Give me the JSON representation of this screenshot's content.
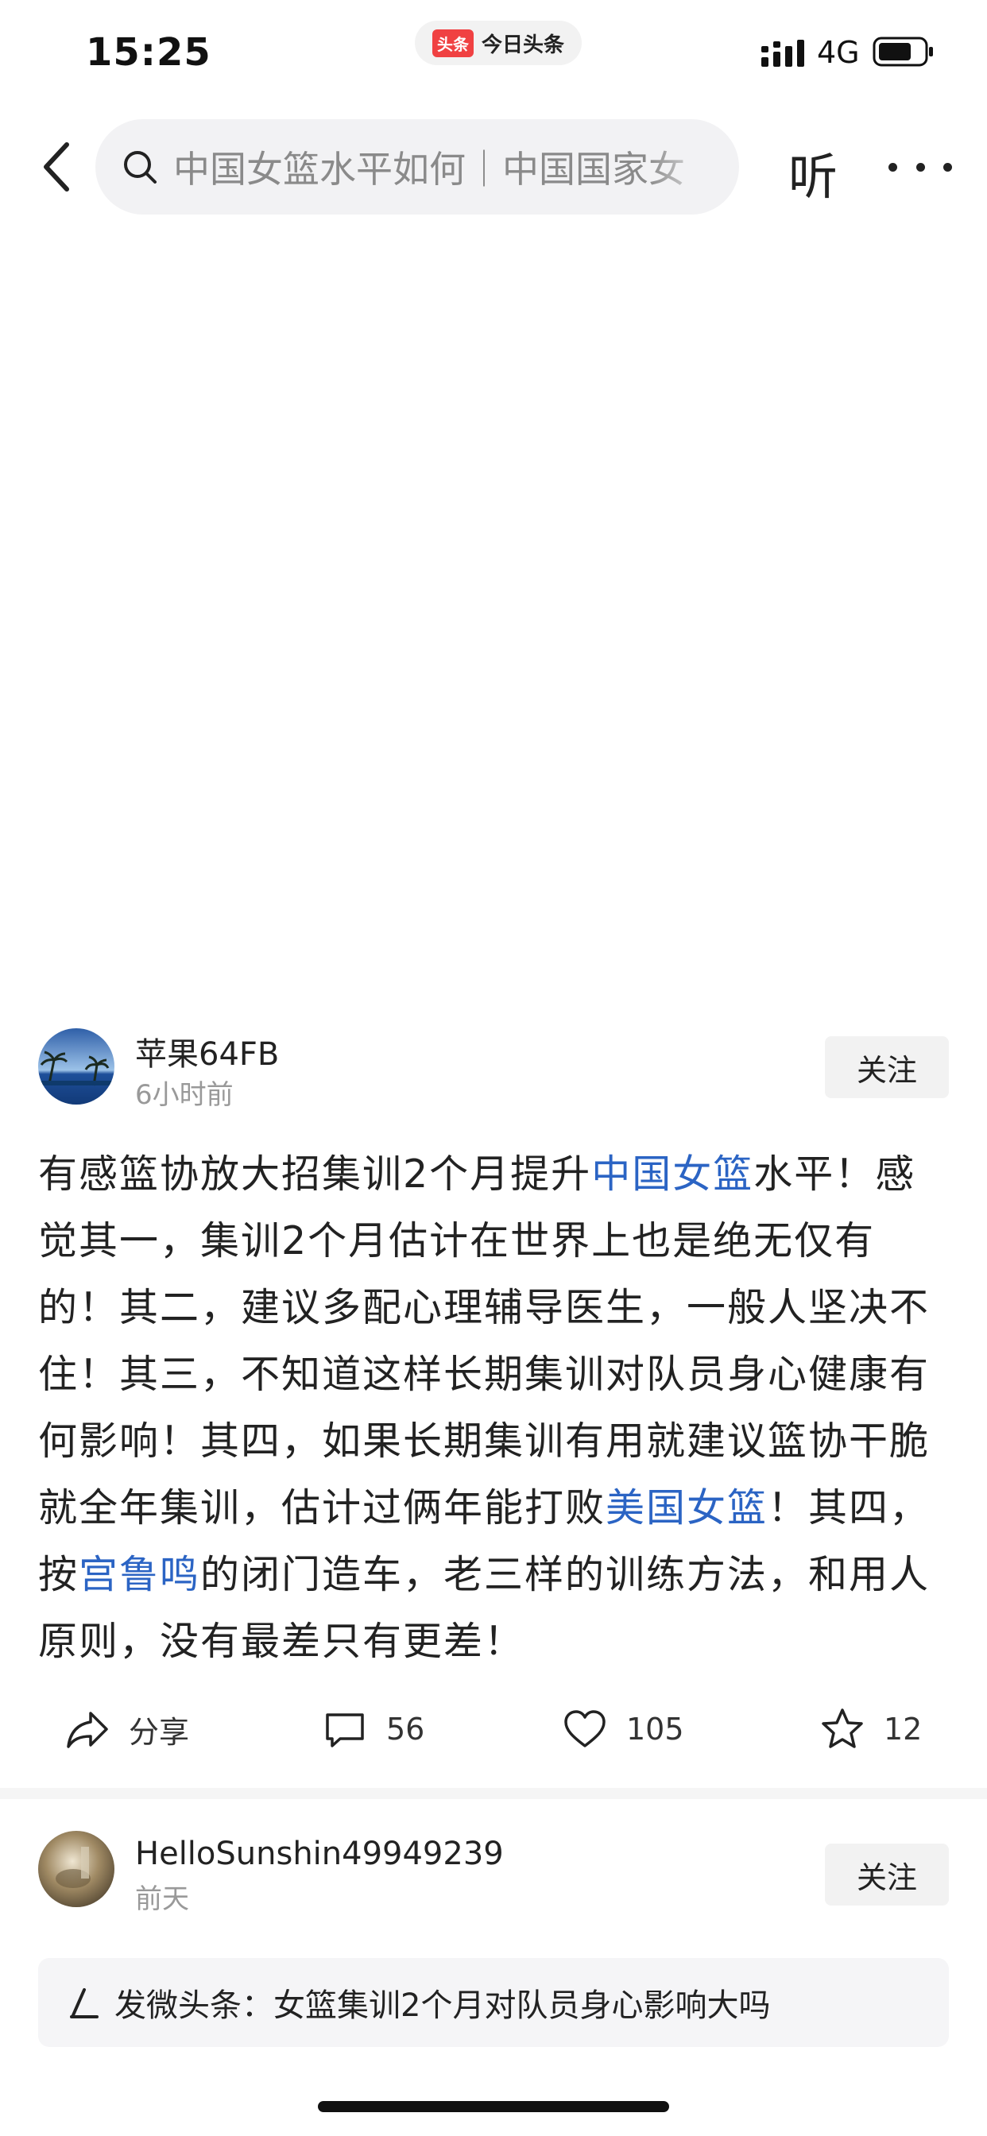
{
  "status_bar": {
    "time": "15:25",
    "app_logo": "头条",
    "app_name": "今日头条",
    "network": "4G",
    "icons": [
      "signal-icon",
      "battery-icon"
    ]
  },
  "nav": {
    "back_icon": "chevron-left-icon",
    "search_icon": "search-icon",
    "search_text": "中国女篮水平如何｜中国国家女",
    "listen_label": "听",
    "more_icon": "more-dots-icon"
  },
  "post": {
    "author": "苹果64FB",
    "time": "6小时前",
    "follow_label": "关注",
    "body": {
      "t1": "有感篮协放大招集训2个月提升",
      "l1": "中国女篮",
      "t2": "水平！感觉其一，集训2个月估计在世界上也是绝无仅有的！其二，建议多配心理辅导医生，一般人坚决不住！其三，不知道这样长期集训对队员身心健康有何影响！其四，如果长期集训有用就建议篮协干脆就全年集训，估计过俩年能打败",
      "l2": "美国女篮",
      "t3": "！其四，按",
      "l3": "宫鲁鸣",
      "t4": "的闭门造车，老三样的训练方法，和用人原则，没有最差只有更差！"
    },
    "actions": {
      "share_label": "分享",
      "comments": "56",
      "likes": "105",
      "favorites": "12"
    }
  },
  "post2": {
    "author": "HelloSunshin49949239",
    "time": "前天",
    "follow_label": "关注"
  },
  "compose": {
    "text": "发微头条：女篮集训2个月对队员身心影响大吗"
  },
  "colors": {
    "link": "#2b64c4",
    "brand": "#f04142"
  }
}
